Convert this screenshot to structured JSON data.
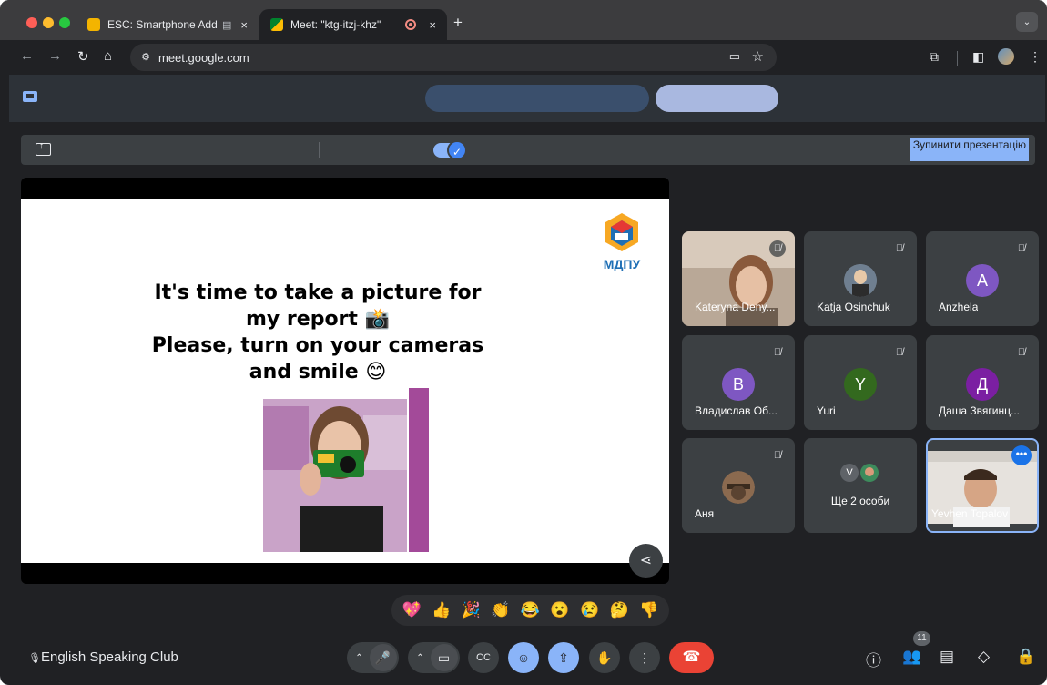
{
  "browser": {
    "tabs": [
      {
        "title": "ESC: Smartphone Addicti",
        "favicon_color": "#f4b400",
        "badge": "▤",
        "close": "×"
      },
      {
        "title": "Meet: \"ktg-itzj-khz\"",
        "favicon_color": "#00897b",
        "close": "×"
      }
    ],
    "new_tab": "+",
    "url": "meet.google.com"
  },
  "presentation_bar": {
    "stop_label": "Зупинити презентацію"
  },
  "slide": {
    "lines": [
      "It's time to take a picture for",
      "my report 📸",
      "Please, turn on your cameras",
      "and smile 😊"
    ],
    "logo_text": "МДПУ"
  },
  "participants": [
    {
      "name": "Kateryna Deny...",
      "type": "video"
    },
    {
      "name": "Katja Osinchuk",
      "type": "photo"
    },
    {
      "name": "Anzhela",
      "initial": "A",
      "color": "#7e57c2"
    },
    {
      "name": "Владислав Об...",
      "initial": "B",
      "color": "#7e57c2"
    },
    {
      "name": "Yuri",
      "initial": "Y",
      "color": "#33691e"
    },
    {
      "name": "Даша Звягинц...",
      "initial": "Д",
      "color": "#7b1fa2"
    },
    {
      "name": "Аня",
      "type": "photo"
    },
    {
      "name": "Ще 2 особи",
      "initial": "V"
    },
    {
      "name": "Yevhen Topalov",
      "type": "video"
    }
  ],
  "reactions": [
    "💖",
    "👍",
    "🎉",
    "👏",
    "😂",
    "😮",
    "😢",
    "🤔",
    "👎"
  ],
  "meeting": {
    "name": "English Speaking Club",
    "people_count": "11"
  },
  "colors": {
    "accent": "#8ab4f8",
    "end_call": "#ea4335",
    "pinned_border": "#8ab4f8"
  }
}
